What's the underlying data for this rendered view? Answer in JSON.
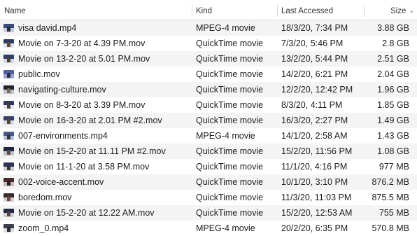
{
  "columns": {
    "name": "Name",
    "kind": "Kind",
    "accessed": "Last Accessed",
    "size": "Size"
  },
  "files": [
    {
      "name": "visa david.mp4",
      "kind": "MPEG-4 movie",
      "accessed": "18/3/20, 7:34 PM",
      "size": "3.88 GB",
      "thumb": {
        "top": "#3a4a7a",
        "bottom": "#c8cde0",
        "fig": "#2a2a35"
      }
    },
    {
      "name": "Movie on 7-3-20 at 4.39 PM.mov",
      "kind": "QuickTime movie",
      "accessed": "7/3/20, 5:46 PM",
      "size": "2.8 GB",
      "thumb": {
        "top": "#2d3b63",
        "bottom": "#e2e2e8",
        "fig": "#5a4a44"
      }
    },
    {
      "name": "Movie on 13-2-20 at 5.01 PM.mov",
      "kind": "QuickTime movie",
      "accessed": "13/2/20, 5:44 PM",
      "size": "2.51 GB",
      "thumb": {
        "top": "#2f3f6a",
        "bottom": "#d8d8e2",
        "fig": "#4a3c3a"
      }
    },
    {
      "name": "public.mov",
      "kind": "QuickTime movie",
      "accessed": "14/2/20, 6:21 PM",
      "size": "2.04 GB",
      "thumb": {
        "top": "#5061a0",
        "bottom": "#9aa4cc",
        "fig": "#2a2e44"
      }
    },
    {
      "name": "navigating-culture.mov",
      "kind": "QuickTime movie",
      "accessed": "12/2/20, 12:42 PM",
      "size": "1.96 GB",
      "thumb": {
        "top": "#20232e",
        "bottom": "#bfc3cc",
        "fig": "#7a6a60"
      }
    },
    {
      "name": "Movie on 8-3-20 at 3.39 PM.mov",
      "kind": "QuickTime movie",
      "accessed": "8/3/20, 4:11 PM",
      "size": "1.85 GB",
      "thumb": {
        "top": "#2d3b63",
        "bottom": "#e6e6ea",
        "fig": "#4a3c3a"
      }
    },
    {
      "name": "Movie on 16-3-20 at 2.01 PM #2.mov",
      "kind": "QuickTime movie",
      "accessed": "16/3/20, 2:27 PM",
      "size": "1.49 GB",
      "thumb": {
        "top": "#33406a",
        "bottom": "#dcdce6",
        "fig": "#55463f"
      }
    },
    {
      "name": "007-environments.mp4",
      "kind": "MPEG-4 movie",
      "accessed": "14/1/20, 2:58 AM",
      "size": "1.43 GB",
      "thumb": {
        "top": "#465a8a",
        "bottom": "#b8c0d8",
        "fig": "#333340"
      }
    },
    {
      "name": "Movie on 15-2-20 at 11.11 PM #2.mov",
      "kind": "QuickTime movie",
      "accessed": "15/2/20, 11:56 PM",
      "size": "1.08 GB",
      "thumb": {
        "top": "#1f2540",
        "bottom": "#c0c2cc",
        "fig": "#5f4c44"
      }
    },
    {
      "name": "Movie on 11-1-20 at 3.58 PM.mov",
      "kind": "QuickTime movie",
      "accessed": "11/1/20, 4:16 PM",
      "size": "977 MB",
      "thumb": {
        "top": "#2a3558",
        "bottom": "#d0d0da",
        "fig": "#3e3230"
      }
    },
    {
      "name": "002-voice-accent.mov",
      "kind": "QuickTime movie",
      "accessed": "10/1/20, 3:10 PM",
      "size": "876.2 MB",
      "thumb": {
        "top": "#4a2a30",
        "bottom": "#c9b8b8",
        "fig": "#2b1e1e"
      }
    },
    {
      "name": "boredom.mov",
      "kind": "QuickTime movie",
      "accessed": "11/3/20, 11:03 PM",
      "size": "875.5 MB",
      "thumb": {
        "top": "#3a2a2a",
        "bottom": "#d6cfcf",
        "fig": "#6a4a40"
      }
    },
    {
      "name": "Movie on 15-2-20 at 12.22 AM.mov",
      "kind": "QuickTime movie",
      "accessed": "15/2/20, 12:53 AM",
      "size": "755 MB",
      "thumb": {
        "top": "#242a45",
        "bottom": "#cfd0da",
        "fig": "#5a4840"
      }
    },
    {
      "name": "zoom_0.mp4",
      "kind": "MPEG-4 movie",
      "accessed": "20/2/20, 6:35 PM",
      "size": "570.8 MB",
      "thumb": {
        "top": "#3b3f4a",
        "bottom": "#e0e0e4",
        "fig": "#2c2c30"
      }
    }
  ]
}
